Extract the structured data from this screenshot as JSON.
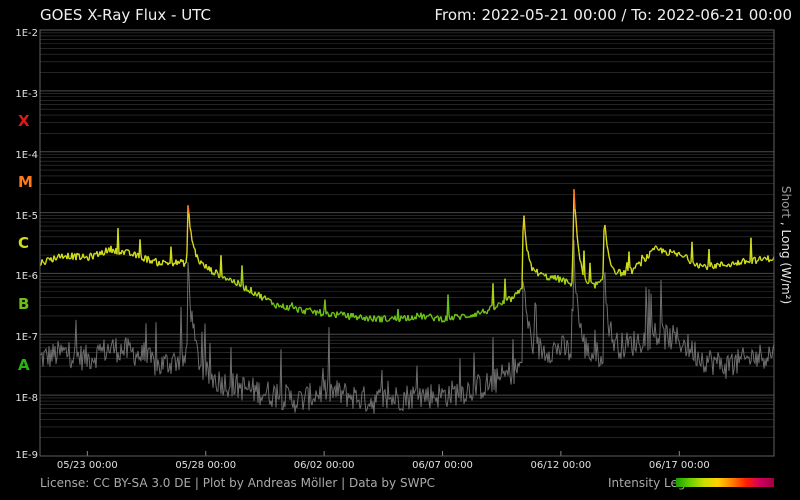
{
  "header": {
    "title": "GOES X-Ray Flux - UTC",
    "range": "From: 2022-05-21 00:00  /  To: 2022-06-21 00:00"
  },
  "footer": {
    "credit": "License: CC BY-SA 3.0 DE | Plot by Andreas Möller | Data by SWPC",
    "legend_label": "Intensity Leg"
  },
  "right_axis": {
    "short": "Short",
    "sep": " , ",
    "long": "Long (W/m²)",
    "short_color": "#9a9a9a",
    "long_color": "#e8e8e8"
  },
  "flare_classes": [
    {
      "label": "X",
      "color": "#e01818"
    },
    {
      "label": "M",
      "color": "#ff7a18"
    },
    {
      "label": "C",
      "color": "#d0dc18"
    },
    {
      "label": "B",
      "color": "#6cc018"
    },
    {
      "label": "A",
      "color": "#2ab018"
    }
  ],
  "colors": {
    "short_channel": "#6e6e6e",
    "grid": "#3a3a3a",
    "frame": "#606060",
    "class_A": "#2ab018",
    "class_B": "#6cc018",
    "class_C": "#d0dc18",
    "class_M": "#ff7a18",
    "class_X": "#e01818"
  },
  "chart_data": {
    "type": "line",
    "title": "GOES X-Ray Flux - UTC",
    "y_scale": "log",
    "ylim": [
      1e-09,
      0.01
    ],
    "y_tick_labels": [
      "1E-2",
      "1E-3",
      "1E-4",
      "1E-5",
      "1E-6",
      "1E-7",
      "1E-8",
      "1E-9"
    ],
    "y_ticks": [
      0.01,
      0.001,
      0.0001,
      1e-05,
      1e-06,
      1e-07,
      1e-08,
      1e-09
    ],
    "xlim": [
      "2022-05-21 00:00",
      "2022-06-21 00:00"
    ],
    "x_ticks": [
      "2022-05-23",
      "2022-05-28",
      "2022-06-02",
      "2022-06-07",
      "2022-06-12",
      "2022-06-17"
    ],
    "x_tick_labels": [
      "05/23 00:00",
      "05/28 00:00",
      "06/02 00:00",
      "06/07 00:00",
      "06/12 00:00",
      "06/17 00:00"
    ],
    "grid": true,
    "series": [
      {
        "name": "Long",
        "x": [
          "2022-05-21",
          "2022-05-22",
          "2022-05-23",
          "2022-05-24",
          "2022-05-25",
          "2022-05-26",
          "2022-05-27",
          "2022-05-28",
          "2022-05-29",
          "2022-05-30",
          "2022-05-31",
          "2022-06-01",
          "2022-06-02",
          "2022-06-03",
          "2022-06-04",
          "2022-06-05",
          "2022-06-06",
          "2022-06-07",
          "2022-06-08",
          "2022-06-09",
          "2022-06-10",
          "2022-06-11",
          "2022-06-12",
          "2022-06-13",
          "2022-06-14",
          "2022-06-15",
          "2022-06-16",
          "2022-06-17",
          "2022-06-18",
          "2022-06-19",
          "2022-06-20",
          "2022-06-21"
        ],
        "values": [
          1.5e-06,
          2e-06,
          1.8e-06,
          2.5e-06,
          2e-06,
          1.5e-06,
          1.5e-06,
          1.2e-06,
          8e-07,
          5e-07,
          3e-07,
          2.5e-07,
          2.2e-07,
          2e-07,
          1.8e-07,
          1.8e-07,
          2e-07,
          1.8e-07,
          2e-07,
          2.5e-07,
          4e-07,
          9e-07,
          8e-07,
          5e-07,
          8e-07,
          1.1e-06,
          2.5e-06,
          2e-06,
          1.3e-06,
          1.4e-06,
          1.6e-06,
          1.8e-06
        ],
        "peaks": [
          {
            "x": "2022-05-27 06:00",
            "value": 1.3e-05
          },
          {
            "x": "2022-06-10 10:00",
            "value": 1.2e-05
          },
          {
            "x": "2022-06-12 13:00",
            "value": 3.2e-05
          },
          {
            "x": "2022-06-13 20:00",
            "value": 8e-06
          }
        ]
      },
      {
        "name": "Short",
        "x": [
          "2022-05-21",
          "2022-05-22",
          "2022-05-23",
          "2022-05-24",
          "2022-05-25",
          "2022-05-26",
          "2022-05-27",
          "2022-05-28",
          "2022-05-29",
          "2022-05-30",
          "2022-05-31",
          "2022-06-01",
          "2022-06-02",
          "2022-06-03",
          "2022-06-04",
          "2022-06-05",
          "2022-06-06",
          "2022-06-07",
          "2022-06-08",
          "2022-06-09",
          "2022-06-10",
          "2022-06-11",
          "2022-06-12",
          "2022-06-13",
          "2022-06-14",
          "2022-06-15",
          "2022-06-16",
          "2022-06-17",
          "2022-06-18",
          "2022-06-19",
          "2022-06-20",
          "2022-06-21"
        ],
        "values": [
          4e-08,
          5e-08,
          4e-08,
          6e-08,
          5e-08,
          3e-08,
          4e-08,
          2e-08,
          1.5e-08,
          1.2e-08,
          1e-08,
          8e-09,
          1.2e-08,
          1e-08,
          8e-09,
          9e-09,
          1e-08,
          1e-08,
          1.2e-08,
          1.5e-08,
          2.5e-08,
          5e-08,
          6e-08,
          4e-08,
          5e-08,
          7e-08,
          1e-07,
          8e-08,
          4e-08,
          3e-08,
          4e-08,
          5e-08
        ],
        "peaks": [
          {
            "x": "2022-05-27 06:00",
            "value": 1.5e-06
          },
          {
            "x": "2022-06-10 10:00",
            "value": 1.2e-06
          },
          {
            "x": "2022-06-12 13:00",
            "value": 3e-06
          },
          {
            "x": "2022-06-13 20:00",
            "value": 8e-07
          }
        ]
      }
    ]
  }
}
